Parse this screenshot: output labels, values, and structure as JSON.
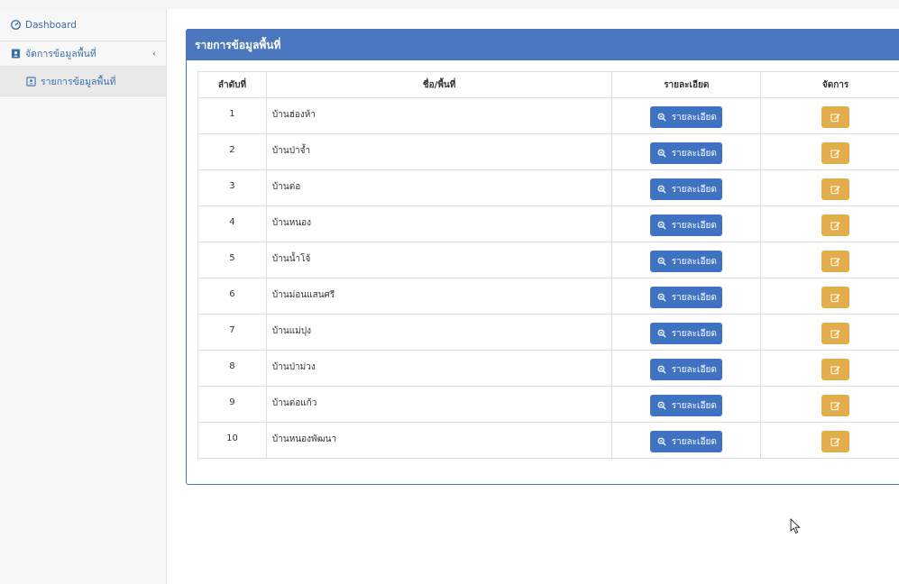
{
  "sidebar": {
    "dashboard": "Dashboard",
    "group": "จัดการข้อมูลพื้นที่",
    "sub": "รายการข้อมูลพื้นที่"
  },
  "panel": {
    "title": "รายการข้อมูลพื้นที่"
  },
  "table": {
    "headers": {
      "num": "ลำดับที่",
      "name": "ชื่อ/พื้นที่",
      "detail": "รายละเอียด",
      "manage": "จัดการ"
    },
    "detail_label": "รายละเอียด",
    "rows": [
      {
        "num": "1",
        "name": "บ้านฮ่องห้า"
      },
      {
        "num": "2",
        "name": "บ้านป่าจ้ำ"
      },
      {
        "num": "3",
        "name": "บ้านต่อ"
      },
      {
        "num": "4",
        "name": "บ้านหนอง"
      },
      {
        "num": "5",
        "name": "บ้านน้ำโจ้"
      },
      {
        "num": "6",
        "name": "บ้านม่อนแสนศรี"
      },
      {
        "num": "7",
        "name": "บ้านแม่ปุง"
      },
      {
        "num": "8",
        "name": "บ้านป่าม่วง"
      },
      {
        "num": "9",
        "name": "บ้านต่อแก้ว"
      },
      {
        "num": "10",
        "name": "บ้านหนองพัฒนา"
      }
    ]
  },
  "colors": {
    "primary": "#4a77bd",
    "detail_button": "#3f73c2",
    "edit_button": "#e4ad4b"
  },
  "icons": {
    "dashboard": "dashboard-icon",
    "group": "address-book-icon",
    "sub": "address-card-icon",
    "detail": "search-plus-icon",
    "edit": "edit-icon"
  }
}
